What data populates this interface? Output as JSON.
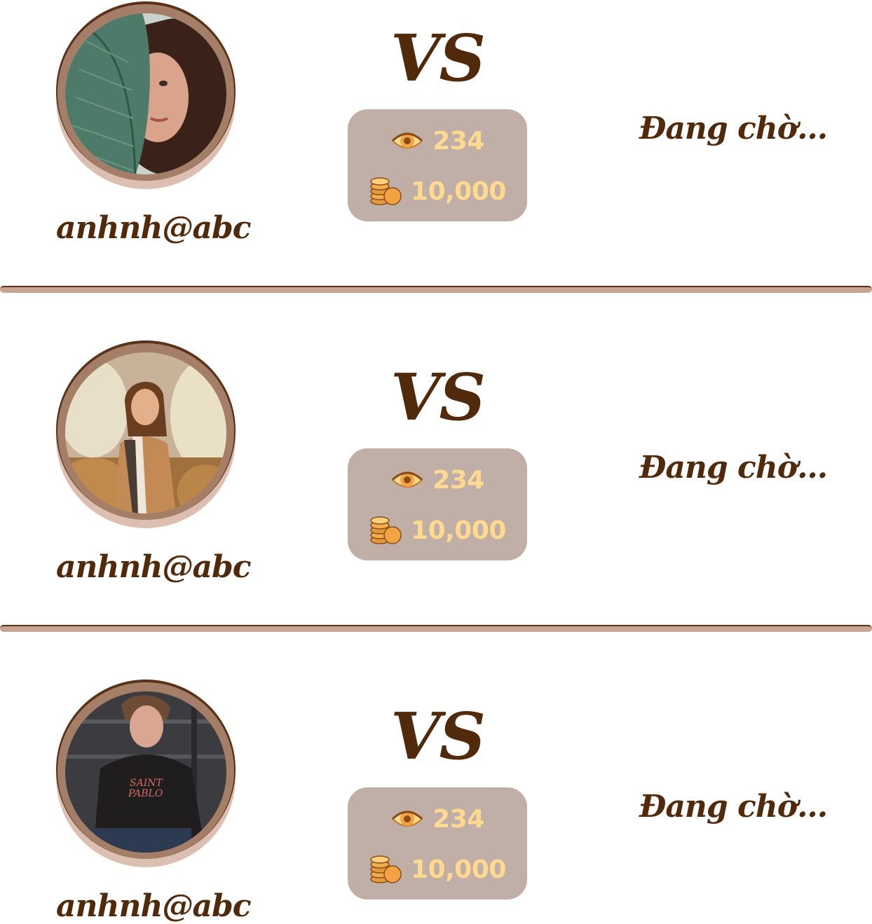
{
  "matches": [
    {
      "username": "anhnh@abc",
      "vs_label": "VS",
      "views": "234",
      "bet": "10,000",
      "status": "Đang chờ..."
    },
    {
      "username": "anhnh@abc",
      "vs_label": "VS",
      "views": "234",
      "bet": "10,000",
      "status": "Đang chờ..."
    },
    {
      "username": "anhnh@abc",
      "vs_label": "VS",
      "views": "234",
      "bet": "10,000",
      "status": "Đang chờ..."
    }
  ],
  "icons": {
    "views": "eye-icon",
    "bet": "coins-icon"
  },
  "colors": {
    "text_brown": "#51290b",
    "stats_box_bg": "#bfafa7",
    "stats_text": "#ffd98f",
    "avatar_ring": "#a57e68",
    "divider": "#c8a493"
  }
}
